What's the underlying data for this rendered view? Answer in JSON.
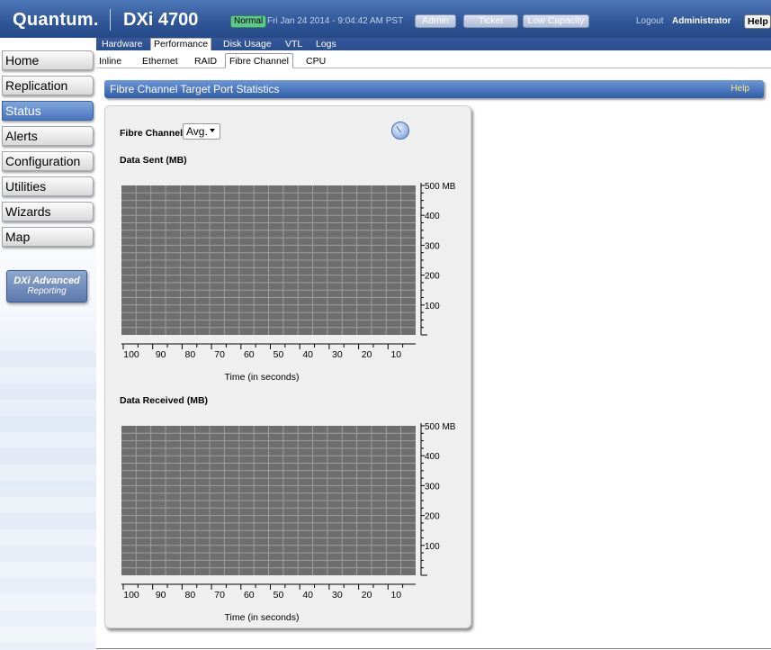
{
  "header": {
    "logo": "Quantum.",
    "product": "DXi 4700",
    "status": "Normal",
    "datetime": "Fri Jan 24 2014 - 9:04:42 AM PST",
    "buttons": {
      "admin": "Admin",
      "ticket": "Ticket",
      "low_capacity": "Low Capacity"
    },
    "logout": "Logout",
    "user": "Administrator",
    "help": "Help"
  },
  "main_tabs": [
    "Hardware",
    "Performance",
    "Disk Usage",
    "VTL",
    "Logs"
  ],
  "main_tabs_active": "Performance",
  "sub_tabs": [
    "Inline",
    "Ethernet",
    "RAID",
    "Fibre Channel",
    "CPU"
  ],
  "sub_tabs_active": "Fibre Channel",
  "sidebar": {
    "items": [
      "Home",
      "Replication",
      "Status",
      "Alerts",
      "Configuration",
      "Utilities",
      "Wizards",
      "Map"
    ],
    "active": "Status",
    "reporting": {
      "line1": "DXi Advanced",
      "line2": "Reporting"
    }
  },
  "section": {
    "title": "Fibre Channel Target Port Statistics",
    "help": "Help"
  },
  "panel": {
    "fc_label": "Fibre Channel",
    "fc_select_value": "Avg.",
    "refresh_icon": "refresh-icon"
  },
  "colors": {
    "grid_bg": "#6e6e6e",
    "grid_line": "#9e9e9e",
    "header_blue": "#2f5ca8",
    "normal_green": "#5ec98a"
  },
  "chart_data": [
    {
      "type": "line",
      "title": "Data Sent (MB)",
      "xlabel": "Time (in seconds)",
      "x_ticks": [
        100,
        90,
        80,
        70,
        60,
        50,
        40,
        30,
        20,
        10
      ],
      "y_ticks": [
        "500 MB",
        "400",
        "300",
        "200",
        "100"
      ],
      "ylim": [
        0,
        500
      ],
      "series": [],
      "grid": true
    },
    {
      "type": "line",
      "title": "Data Received (MB)",
      "xlabel": "Time (in seconds)",
      "x_ticks": [
        100,
        90,
        80,
        70,
        60,
        50,
        40,
        30,
        20,
        10
      ],
      "y_ticks": [
        "500 MB",
        "400",
        "300",
        "200",
        "100"
      ],
      "ylim": [
        0,
        500
      ],
      "series": [],
      "grid": true
    }
  ]
}
